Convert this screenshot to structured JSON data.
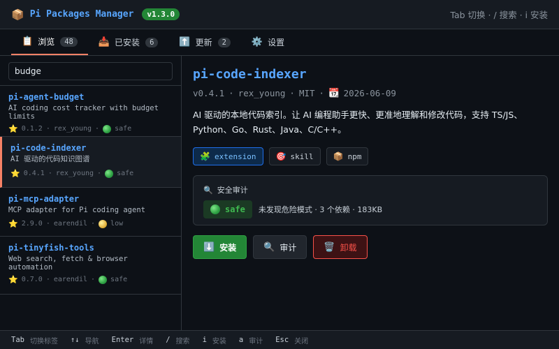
{
  "header": {
    "icon": "package-icon",
    "title": "Pi Packages Manager",
    "version": "v1.3.0",
    "hints": "Tab 切换 · / 搜索 · i 安装"
  },
  "tabs": [
    {
      "icon": "clipboard-icon",
      "glyph": "📋",
      "label": "浏览",
      "count": "48",
      "active": true
    },
    {
      "icon": "inbox-tray-icon",
      "glyph": "📥",
      "label": "已安装",
      "count": "6",
      "active": false
    },
    {
      "icon": "arrow-up-icon",
      "glyph": "⬆️",
      "label": "更新",
      "count": "2",
      "active": false
    },
    {
      "icon": "gear-icon",
      "glyph": "⚙️",
      "label": "设置",
      "count": "",
      "active": false
    }
  ],
  "search": {
    "value": "budge",
    "placeholder": ""
  },
  "packages": [
    {
      "name": "pi-agent-budget",
      "desc": "AI coding cost tracker with budget limits",
      "stars": "0.1.2",
      "author": "rex_young",
      "risk": "safe"
    },
    {
      "name": "pi-code-indexer",
      "desc": "AI 驱动的代码知识图谱",
      "stars": "0.4.1",
      "author": "rex_young",
      "risk": "safe"
    },
    {
      "name": "pi-mcp-adapter",
      "desc": "MCP adapter for Pi coding agent",
      "stars": "2.9.0",
      "author": "earendil",
      "risk": "low"
    },
    {
      "name": "pi-tinyfish-tools",
      "desc": "Web search, fetch & browser automation",
      "stars": "0.7.0",
      "author": "earendil",
      "risk": "safe"
    }
  ],
  "selected_index": 1,
  "detail": {
    "name": "pi-code-indexer",
    "version": "v0.4.1",
    "author": "rex_young",
    "license": "MIT",
    "date": "2026-06-09",
    "description": "AI 驱动的本地代码索引。让 AI 编程助手更快、更准地理解和修改代码，支持 TS/JS、Python、Go、Rust、Java、C/C++。",
    "tags": [
      {
        "icon": "puzzle-icon",
        "glyph": "🧩",
        "label": "extension",
        "primary": true
      },
      {
        "icon": "target-icon",
        "glyph": "🎯",
        "label": "skill",
        "primary": false
      },
      {
        "icon": "package-icon",
        "glyph": "📦",
        "label": "npm",
        "primary": false
      }
    ],
    "audit": {
      "title": "安全审计",
      "status": "safe",
      "summary": "未发现危险模式 · 3 个依赖 · 183KB"
    },
    "actions": {
      "install": "安装",
      "audit": "审计",
      "uninstall": "卸载"
    }
  },
  "footer": [
    {
      "key": "Tab",
      "desc": "切换标签"
    },
    {
      "key": "↑↓",
      "desc": "导航"
    },
    {
      "key": "Enter",
      "desc": "详情"
    },
    {
      "key": "/",
      "desc": "搜索"
    },
    {
      "key": "i",
      "desc": "安装"
    },
    {
      "key": "a",
      "desc": "审计"
    },
    {
      "key": "Esc",
      "desc": "关闭"
    }
  ],
  "colors": {
    "accent": "#58a6ff",
    "success": "#238636",
    "danger": "#f85149",
    "active_tab": "#f78166",
    "bg": "#0d1117"
  }
}
